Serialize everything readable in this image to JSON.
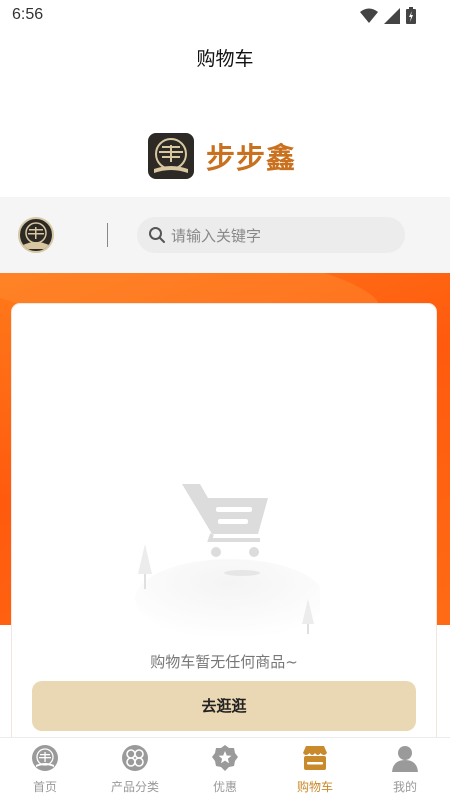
{
  "status_bar": {
    "time": "6:56"
  },
  "header": {
    "title": "购物车"
  },
  "brand": {
    "name": "步步鑫"
  },
  "search": {
    "placeholder": "请输入关键字"
  },
  "cart": {
    "empty_text": "购物车暂无任何商品~",
    "go_shop_label": "去逛逛"
  },
  "tabs": [
    {
      "label": "首页",
      "icon": "home-logo-icon",
      "active": false
    },
    {
      "label": "产品分类",
      "icon": "category-icon",
      "active": false
    },
    {
      "label": "优惠",
      "icon": "discount-icon",
      "active": false
    },
    {
      "label": "购物车",
      "icon": "shop-cart-icon",
      "active": true
    },
    {
      "label": "我的",
      "icon": "profile-icon",
      "active": false
    }
  ],
  "colors": {
    "accent": "#c98a2b",
    "brand_text": "#c9711e",
    "band": "#ff5a0e",
    "button": "#ead7b3"
  }
}
